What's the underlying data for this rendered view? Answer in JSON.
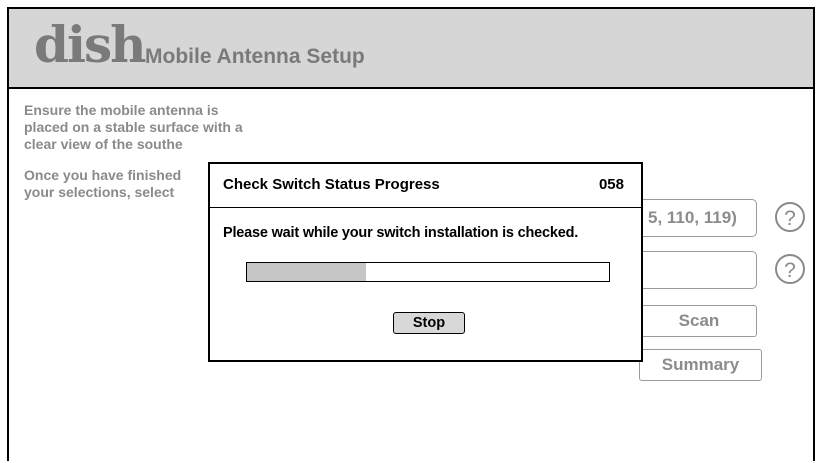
{
  "header": {
    "logo": "dish",
    "title": "Mobile Antenna Setup"
  },
  "instructions": {
    "line1": "Ensure the mobile antenna is",
    "line2": "placed on a stable surface with a",
    "line3": "clear view of the southe",
    "line4": "Once you have finished",
    "line5": "your selections, select"
  },
  "settings": {
    "satellites_value": "5, 110, 119)",
    "second_value": "",
    "scan_label": "Scan",
    "summary_label": "Summary",
    "help_label": "?"
  },
  "dialog": {
    "title": "Check Switch Status Progress",
    "code": "058",
    "message": "Please wait while your switch installation is checked.",
    "progress_fraction": 0.33,
    "stop_label": "Stop"
  },
  "colors": {
    "header_bg": "#d6d6d6",
    "progress_fill": "#c6c6c6",
    "muted_text": "#8a8a8a"
  }
}
